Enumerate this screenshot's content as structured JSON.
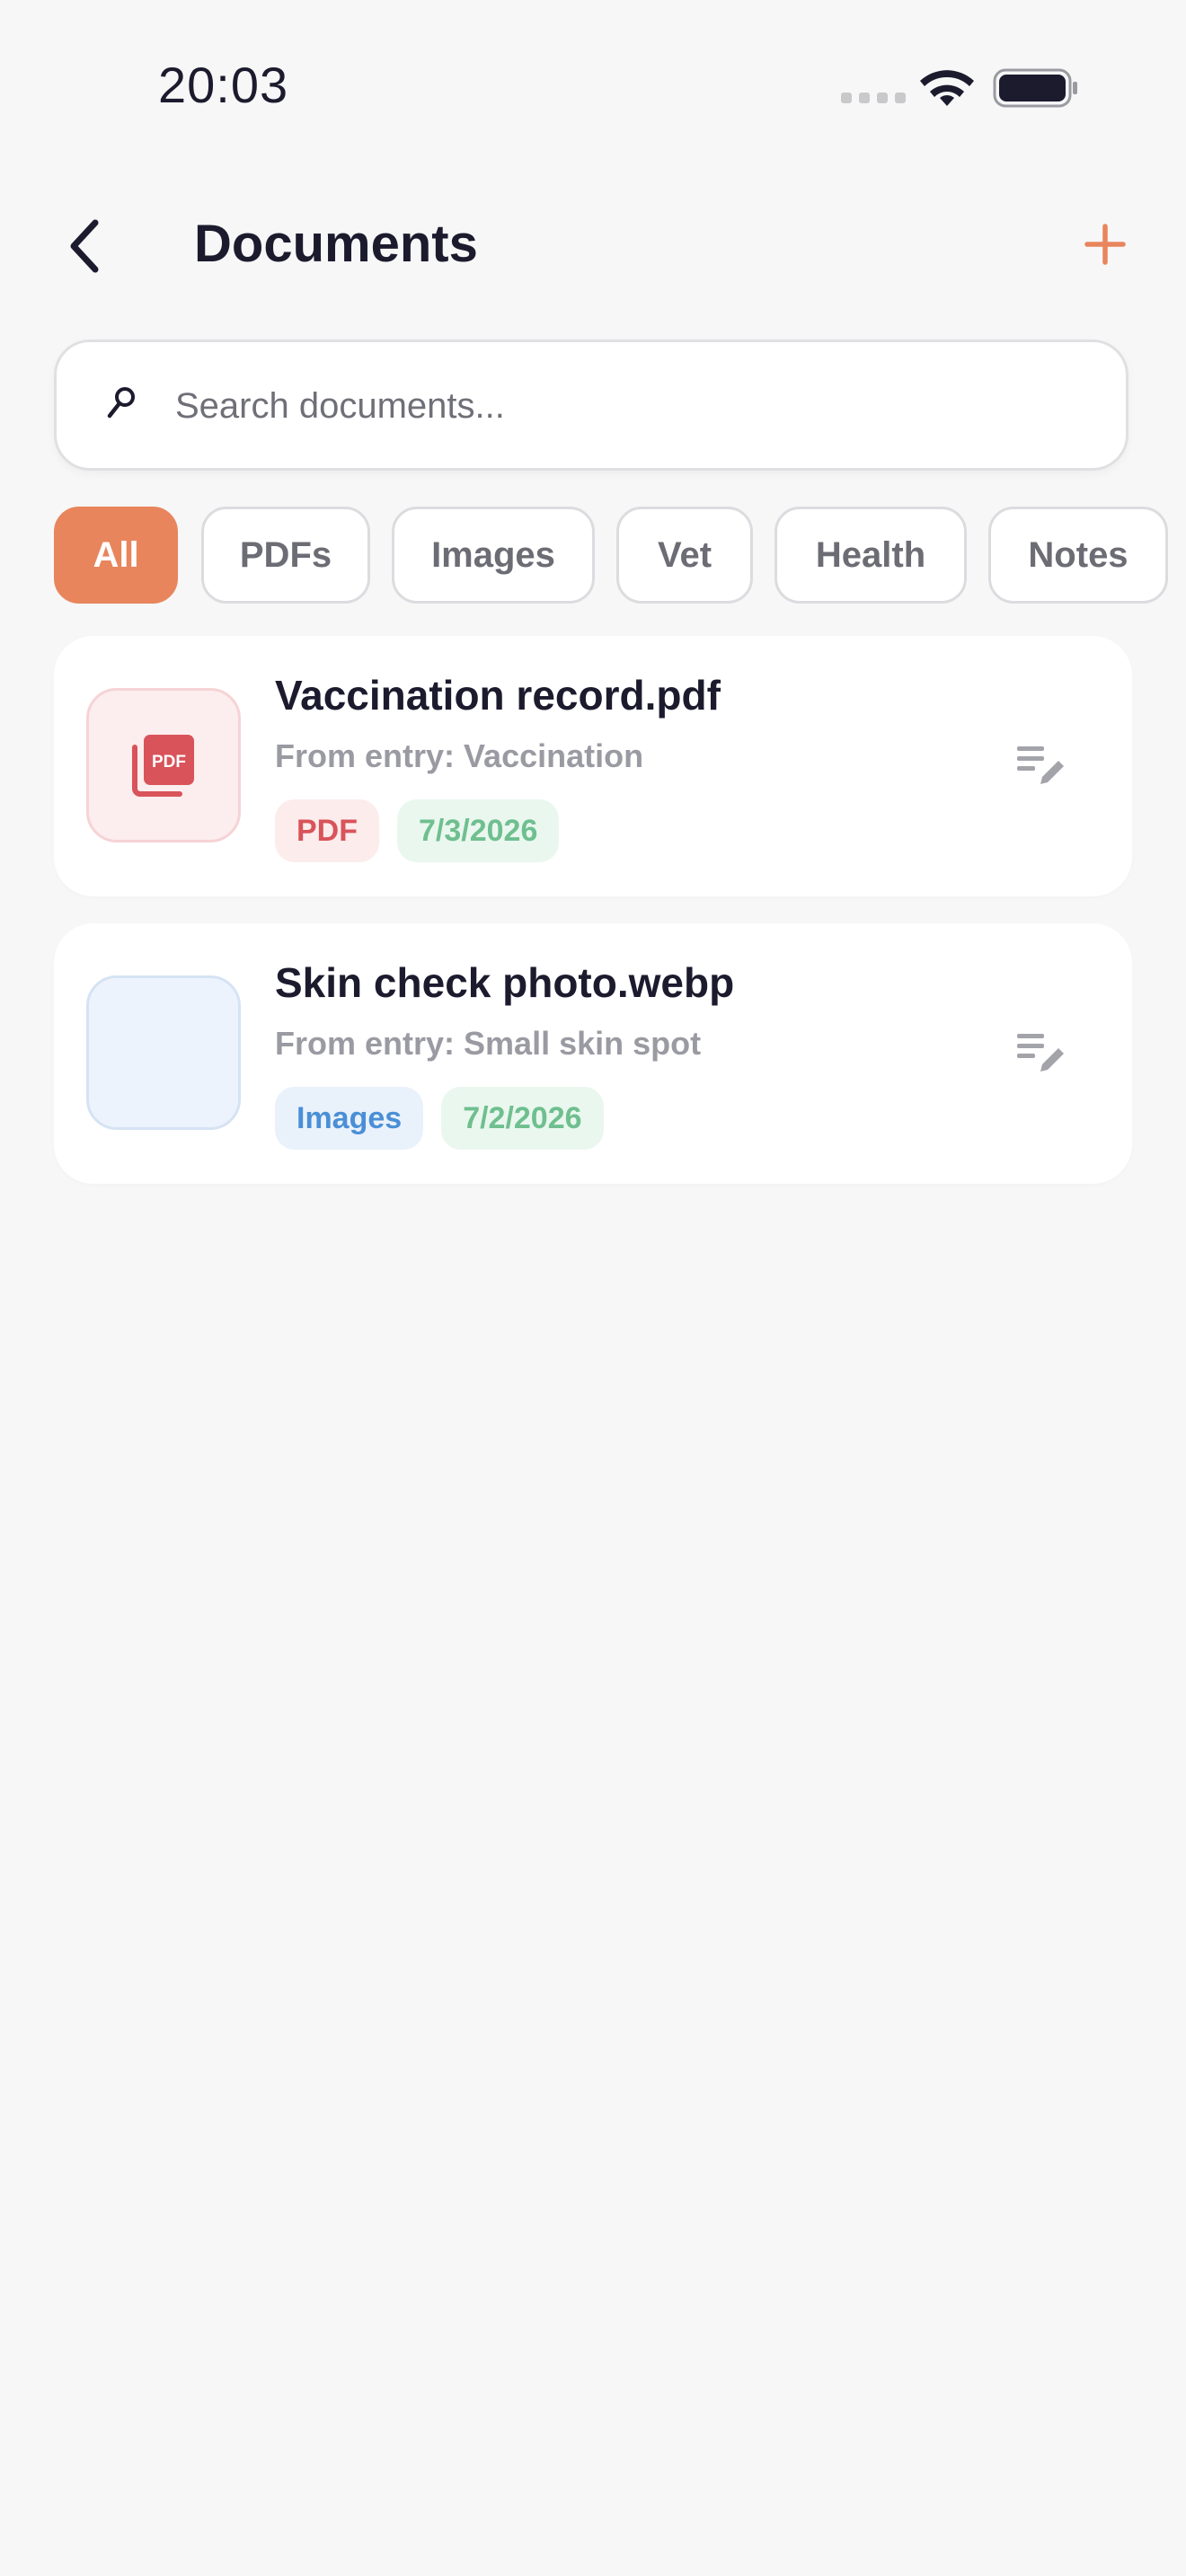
{
  "status_bar": {
    "time": "20:03"
  },
  "header": {
    "title": "Documents",
    "back_icon": "chevron-left-icon",
    "add_icon": "plus-icon"
  },
  "search": {
    "placeholder": "Search documents...",
    "value": ""
  },
  "filters": [
    {
      "label": "All",
      "active": true
    },
    {
      "label": "PDFs",
      "active": false
    },
    {
      "label": "Images",
      "active": false
    },
    {
      "label": "Vet",
      "active": false
    },
    {
      "label": "Health",
      "active": false
    },
    {
      "label": "Notes",
      "active": false
    }
  ],
  "documents": [
    {
      "title": "Vaccination record.pdf",
      "source": "From entry: Vaccination",
      "type_tag": "PDF",
      "date": "7/3/2026",
      "icon": "pdf-file-icon"
    },
    {
      "title": "Skin check photo.webp",
      "source": "From entry: Small skin spot",
      "type_tag": "Images",
      "date": "7/2/2026",
      "icon": "image-thumbnail"
    }
  ],
  "colors": {
    "accent": "#e8855c",
    "background": "#f7f7f7",
    "title_text": "#1c1b2e",
    "pdf_red": "#d9535a",
    "image_blue": "#4a8fd6",
    "date_green": "#6fbf8f"
  }
}
